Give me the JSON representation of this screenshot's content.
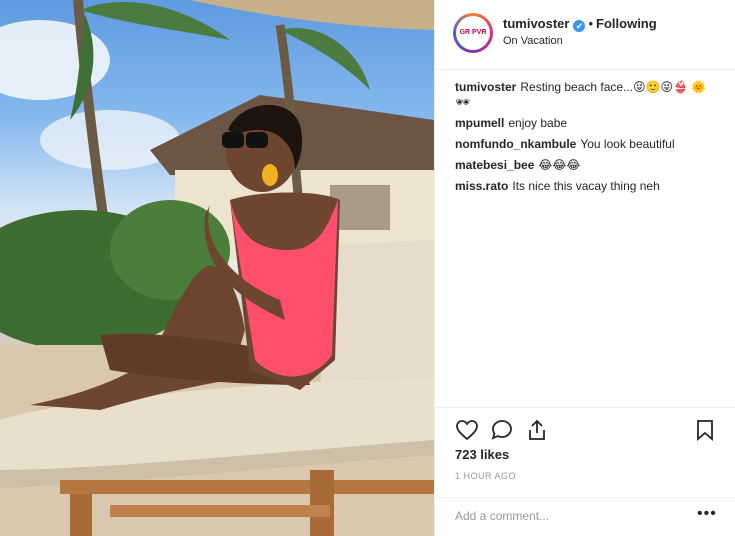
{
  "post": {
    "username": "tumivoster",
    "verified_mark": "✔",
    "separator": "•",
    "follow_status": "Following",
    "location": "On Vacation",
    "avatar_text": "GR PVR"
  },
  "comments": [
    {
      "user": "tumivoster",
      "text": "Resting beach face...😜🙂😜👙 🌞🕶"
    },
    {
      "user": "mpumell",
      "text": "enjoy babe"
    },
    {
      "user": "nomfundo_nkambule",
      "text": "You look beautiful"
    },
    {
      "user": "matebesi_bee",
      "text": "😂😂😂"
    },
    {
      "user": "miss.rato",
      "text": "Its nice this vacay thing neh"
    }
  ],
  "stats": {
    "likes": "723 likes",
    "time": "1 HOUR AGO"
  },
  "composer": {
    "placeholder": "Add a comment...",
    "more": "•••"
  },
  "icons": [
    "heart-icon",
    "comment-icon",
    "share-icon",
    "bookmark-icon",
    "more-options-icon",
    "verified-badge-icon"
  ],
  "colors": {
    "link_blue": "#3897f0",
    "text": "#262626",
    "muted": "#999999",
    "divider": "#efefef",
    "swimsuit": "#ff4f6d"
  }
}
